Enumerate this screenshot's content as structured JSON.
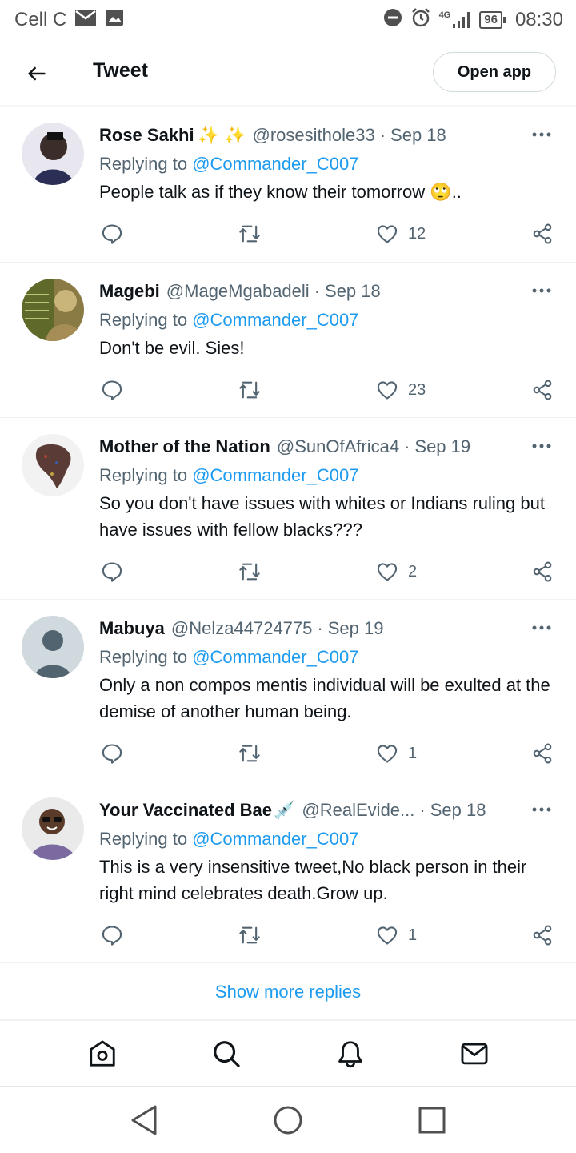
{
  "status_bar": {
    "carrier": "Cell C",
    "network": "4G",
    "battery": "96",
    "time": "08:30"
  },
  "header": {
    "title": "Tweet",
    "open_app_label": "Open app"
  },
  "replying_prefix": "Replying to",
  "replies": [
    {
      "name": "Rose Sakhi",
      "name_emoji": "✨ ✨",
      "handle": "@rosesithole33",
      "date": "Sep 18",
      "mention": "@Commander_C007",
      "text": "People talk as if they know their tomorrow 🙄..",
      "likes": "12"
    },
    {
      "name": "Magebi",
      "name_emoji": "",
      "handle": "@MageMgabadeli",
      "date": "Sep 18",
      "mention": "@Commander_C007",
      "text": "Don't be evil. Sies!",
      "likes": "23"
    },
    {
      "name": "Mother of the Nation",
      "name_emoji": "",
      "handle": "@SunOfAfrica4",
      "date": "Sep 19",
      "mention": "@Commander_C007",
      "text": "So you don't have issues with whites or Indians ruling but have issues with fellow blacks???",
      "likes": "2"
    },
    {
      "name": "Mabuya",
      "name_emoji": "",
      "handle": "@Nelza44724775",
      "date": "Sep 19",
      "mention": "@Commander_C007",
      "text": "Only a non compos mentis individual will be exulted at the demise of another human being.",
      "likes": "1"
    },
    {
      "name": "Your Vaccinated Bae",
      "name_emoji": "💉",
      "handle": "@RealEvide...",
      "date": "Sep 18",
      "mention": "@Commander_C007",
      "text": "This is a very insensitive tweet,No black person in their right mind celebrates death.Grow up.",
      "likes": "1"
    }
  ],
  "show_more_label": "Show more replies",
  "colors": {
    "accent": "#1d9bf0",
    "secondary_text": "#536471",
    "primary_text": "#0f1419",
    "divider": "#eff3f4"
  }
}
